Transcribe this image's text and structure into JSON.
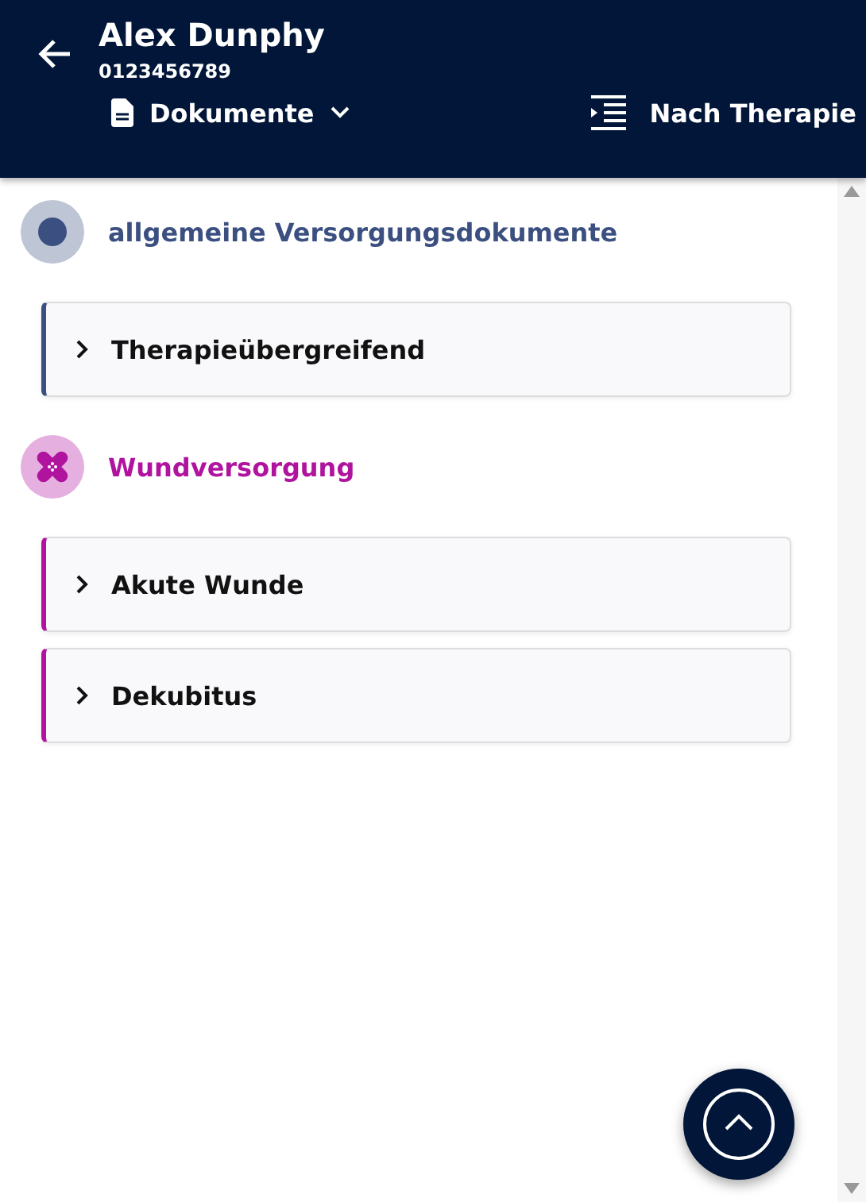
{
  "header": {
    "name": "Alex Dunphy",
    "number": "0123456789",
    "view": "Dokumente",
    "sort": "Nach Therapie"
  },
  "groups": [
    {
      "title": "allgemeine Versorgungsdokumente",
      "kind": "dot",
      "color": "#3b5080",
      "items": [
        {
          "label": "Therapieübergreifend",
          "expanded": false
        }
      ]
    },
    {
      "title": "Wundversorgung",
      "kind": "bandage",
      "color": "#b0139e",
      "items": [
        {
          "label": "Akute Wunde",
          "expanded": false
        },
        {
          "label": "Dekubitus",
          "expanded": false
        }
      ]
    }
  ]
}
